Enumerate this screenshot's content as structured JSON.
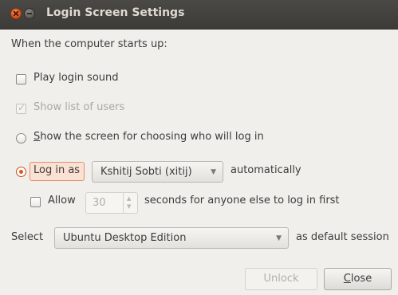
{
  "window": {
    "title": "Login Screen Settings",
    "close_icon": "close-icon",
    "minimize_icon": "minimize-icon"
  },
  "section": {
    "heading": "When the computer starts up:"
  },
  "options": {
    "play_login_sound": {
      "label": "Play login sound",
      "checked": false
    },
    "show_list_of_users": {
      "label": "Show list of users",
      "checked": true,
      "disabled": true
    },
    "show_screen_for_choosing": {
      "label_prefix": "S",
      "label_rest": "how the screen for choosing who will log in",
      "selected": false
    },
    "log_in_as": {
      "label": "Log in as",
      "selected": true,
      "user": "Kshitij Sobti (xitij)",
      "suffix": "automatically"
    },
    "allow": {
      "label": "Allow",
      "checked": false,
      "seconds_value": "30",
      "suffix": "seconds for anyone else to log in first"
    }
  },
  "session": {
    "select_label": "Select",
    "value": "Ubuntu Desktop Edition",
    "suffix": "as default session"
  },
  "buttons": {
    "unlock": "Unlock",
    "close_prefix": "C",
    "close_rest": "lose"
  },
  "colors": {
    "accent": "#e0561f",
    "titlebar": "#3c3b37",
    "background": "#f0efeb"
  }
}
